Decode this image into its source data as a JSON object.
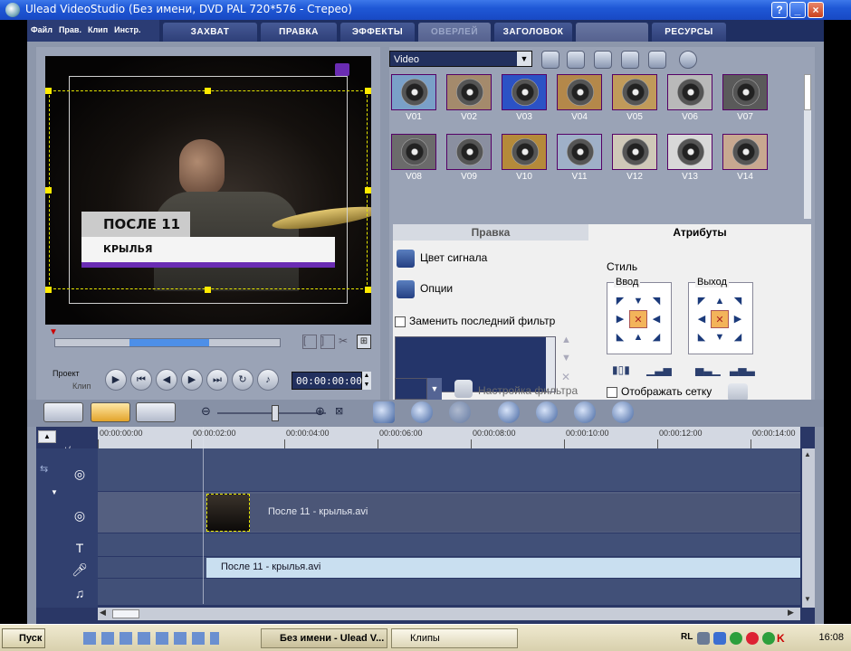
{
  "window": {
    "title": "Ulead VideoStudio (Без имени, DVD PAL 720*576 - Стерео)"
  },
  "menus": [
    "Файл",
    "Прав.",
    "Клип",
    "Инстр."
  ],
  "steps": [
    {
      "label": "ЗАХВАТ",
      "enabled": true
    },
    {
      "label": "ПРАВКА",
      "enabled": true
    },
    {
      "label": "ЭФФЕКТЫ",
      "enabled": true
    },
    {
      "label": "ОВЕРЛЕЙ",
      "enabled": false
    },
    {
      "label": "ЗАГОЛОВОК",
      "enabled": true
    },
    {
      "label": "",
      "enabled": false
    },
    {
      "label": "РЕСУРСЫ",
      "enabled": true
    }
  ],
  "preview": {
    "title_line1": "ПОСЛЕ 11",
    "title_line2": "КРЫЛЬЯ",
    "mode_project": "Проект",
    "mode_clip": "Клип",
    "timecode": "00:00:00:00"
  },
  "library": {
    "category": "Video",
    "thumbs": [
      "V01",
      "V02",
      "V03",
      "V04",
      "V05",
      "V06",
      "V07",
      "V08",
      "V09",
      "V10",
      "V11",
      "V12",
      "V13",
      "V14"
    ]
  },
  "attributes": {
    "tab_edit": "Правка",
    "tab_attributes": "Атрибуты",
    "signal_color": "Цвет сигнала",
    "options": "Опции",
    "replace_last_filter": "Заменить последний фильтр",
    "filter_settings": "Настройка фильтра",
    "style": "Стиль",
    "in_label": "Ввод",
    "out_label": "Выход",
    "show_grid": "Отображать сетку"
  },
  "timeline": {
    "ruler": [
      "00:00:00:00",
      "00:00:02:00",
      "00:00:04:00",
      "00:00:06:00",
      "00:00:08:00",
      "00:00:10:00",
      "00:00:12:00",
      "00:00:14:00"
    ],
    "video_clip": "После 11 - крылья.avi",
    "audio_clip": "После 11 - крылья.avi",
    "add_label": "+/−"
  },
  "taskbar": {
    "start": "Пуск",
    "tasks": [
      "Без имени - Ulead V...",
      "Клипы"
    ],
    "lang": "RL",
    "clock": "16:08"
  },
  "colors": {
    "accent": "#1f2f62",
    "title_bar": "#1f58d6"
  }
}
